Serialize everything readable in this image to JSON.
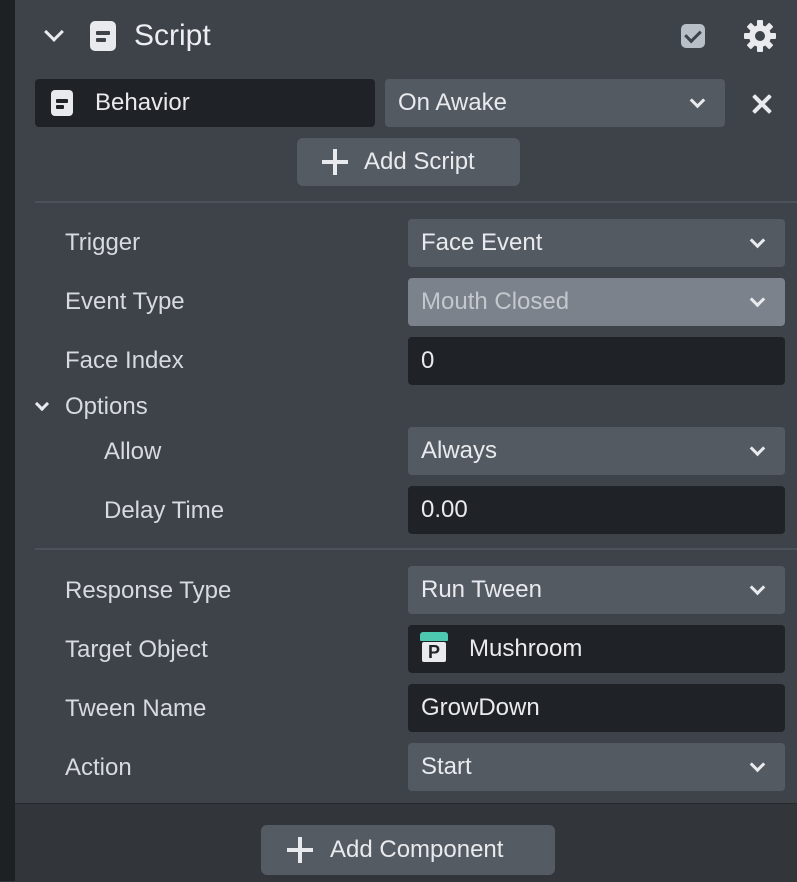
{
  "header": {
    "title": "Script",
    "enabled": true
  },
  "behavior_row": {
    "script_name": "Behavior",
    "event": "On Awake"
  },
  "add_script_label": "Add Script",
  "trigger": {
    "label": "Trigger",
    "value": "Face Event"
  },
  "event_type": {
    "label": "Event Type",
    "value": "Mouth Closed"
  },
  "face_index": {
    "label": "Face Index",
    "value": "0"
  },
  "options": {
    "label": "Options",
    "allow": {
      "label": "Allow",
      "value": "Always"
    },
    "delay_time": {
      "label": "Delay Time",
      "value": "0.00"
    }
  },
  "response_type": {
    "label": "Response Type",
    "value": "Run Tween"
  },
  "target_object": {
    "label": "Target Object",
    "value": "Mushroom",
    "icon_letter": "P"
  },
  "tween_name": {
    "label": "Tween Name",
    "value": "GrowDown"
  },
  "action": {
    "label": "Action",
    "value": "Start"
  },
  "add_component_label": "Add Component",
  "colors": {
    "panel": "#3e4349",
    "field_dark": "#1f2226",
    "dropdown": "#545a62",
    "prefab_accent": "#4cc9b0"
  },
  "icons": [
    "chevron-down-icon",
    "script-icon",
    "checkbox-icon",
    "gear-icon",
    "close-icon",
    "plus-icon",
    "prefab-icon"
  ]
}
